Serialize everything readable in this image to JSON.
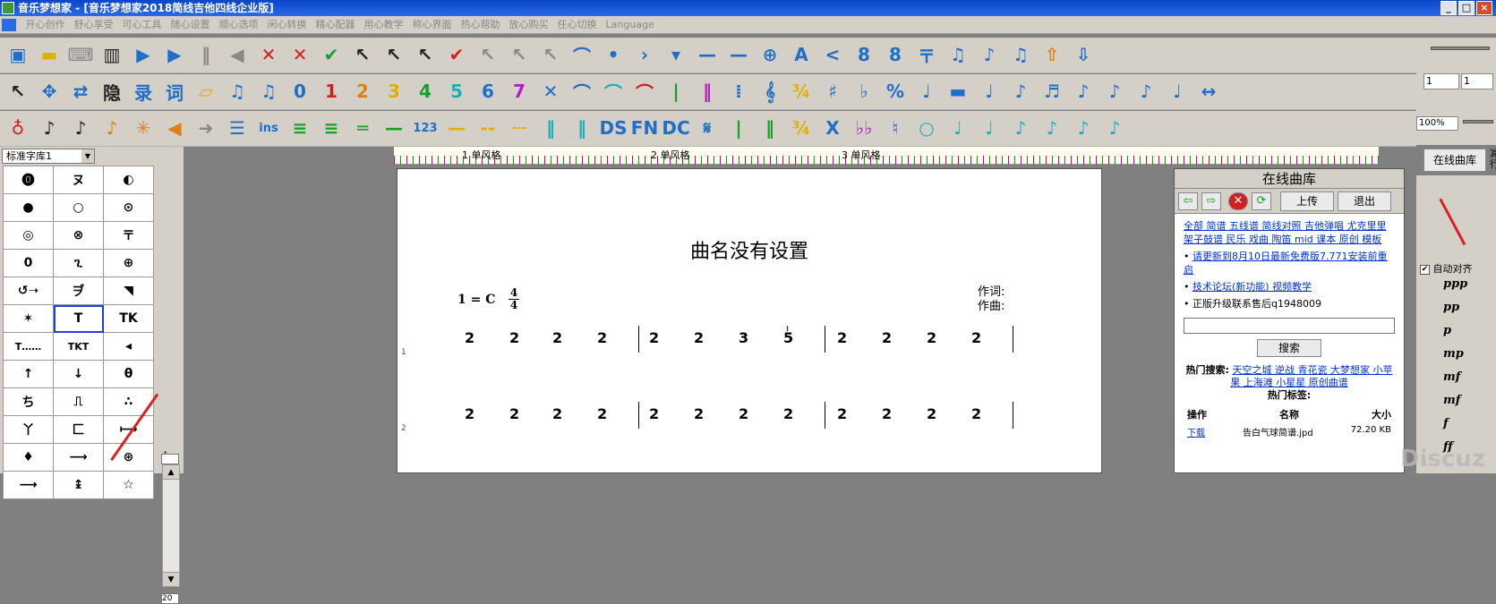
{
  "window": {
    "title": "音乐梦想家 - [音乐梦想家2018简线吉他四线企业版]",
    "min_label": "_",
    "max_label": "□",
    "close_label": "×"
  },
  "menu": [
    "开心创作",
    "舒心享受",
    "可心工具",
    "随心设置",
    "顺心选项",
    "闲心转换",
    "精心配器",
    "用心教学",
    "称心界面",
    "热心帮助",
    "放心购买",
    "任心切换",
    "Language"
  ],
  "toolbar1": [
    {
      "icon": "save-icon",
      "g": "▣",
      "c": "blue"
    },
    {
      "icon": "folder-icon",
      "g": "▬",
      "c": "yellow"
    },
    {
      "icon": "keyboard-icon",
      "g": "⌨",
      "c": "gray"
    },
    {
      "icon": "piano-icon",
      "g": "▥",
      "c": "dk"
    },
    {
      "icon": "play-icon",
      "g": "▶",
      "c": "blue"
    },
    {
      "icon": "play-from-icon",
      "g": "▶",
      "c": "blue"
    },
    {
      "icon": "pause-icon",
      "g": "‖",
      "c": "gray"
    },
    {
      "icon": "rewind-icon",
      "g": "◀",
      "c": "gray"
    },
    {
      "icon": "cut-icon",
      "g": "✕",
      "c": "red"
    },
    {
      "icon": "cut-red-icon",
      "g": "✕",
      "c": "red"
    },
    {
      "icon": "check-icon",
      "g": "✔",
      "c": "green"
    },
    {
      "icon": "select-color-icon",
      "g": "↖",
      "c": "dk"
    },
    {
      "icon": "select2-icon",
      "g": "↖",
      "c": "dk"
    },
    {
      "icon": "select3-icon",
      "g": "↖",
      "c": "dk"
    },
    {
      "icon": "abc-icon",
      "g": "✔",
      "c": "red"
    },
    {
      "icon": "select4-icon",
      "g": "↖",
      "c": "gray"
    },
    {
      "icon": "select5-icon",
      "g": "↖",
      "c": "gray"
    },
    {
      "icon": "select6-icon",
      "g": "↖",
      "c": "gray"
    },
    {
      "icon": "fermata-icon",
      "g": "⌒",
      "c": "blue"
    },
    {
      "icon": "dot-icon",
      "g": "•",
      "c": "blue"
    },
    {
      "icon": "chevron-right-icon",
      "g": "›",
      "c": "blue"
    },
    {
      "icon": "triangle-down-icon",
      "g": "▾",
      "c": "blue"
    },
    {
      "icon": "dash-icon",
      "g": "—",
      "c": "blue"
    },
    {
      "icon": "long-dash-icon",
      "g": "—",
      "c": "blue"
    },
    {
      "icon": "target-icon",
      "g": "⊕",
      "c": "blue"
    },
    {
      "icon": "text-a-icon",
      "g": "A",
      "c": "blue"
    },
    {
      "icon": "less-than-icon",
      "g": "<",
      "c": "blue"
    },
    {
      "icon": "add-8-icon",
      "g": "8",
      "c": "blue"
    },
    {
      "icon": "remove-8-icon",
      "g": "8",
      "c": "blue"
    },
    {
      "icon": "fork-icon",
      "g": "〒",
      "c": "blue"
    },
    {
      "icon": "note-icon",
      "g": "♫",
      "c": "blue"
    },
    {
      "icon": "note2-icon",
      "g": "♪",
      "c": "blue"
    },
    {
      "icon": "note3-icon",
      "g": "♫",
      "c": "blue"
    },
    {
      "icon": "upload-icon",
      "g": "⇧",
      "c": "orange"
    },
    {
      "icon": "download-icon",
      "g": "⇩",
      "c": "blue"
    }
  ],
  "toolbar2": [
    {
      "icon": "pointer-icon",
      "g": "↖",
      "c": "dk"
    },
    {
      "icon": "move-icon",
      "g": "✥",
      "c": "blue"
    },
    {
      "icon": "swap-icon",
      "g": "⇄",
      "c": "blue"
    },
    {
      "icon": "hide-icon",
      "g": "隐",
      "c": "dk"
    },
    {
      "icon": "record-icon",
      "g": "录",
      "c": "blue"
    },
    {
      "icon": "lyric-icon",
      "g": "词",
      "c": "blue"
    },
    {
      "icon": "eraser-icon",
      "g": "▱",
      "c": "yellow"
    },
    {
      "icon": "beam-icon",
      "g": "♫",
      "c": "blue"
    },
    {
      "icon": "beam2-icon",
      "g": "♫",
      "c": "blue"
    },
    {
      "icon": "num-0-icon",
      "g": "0",
      "c": "blue"
    },
    {
      "icon": "num-1-icon",
      "g": "1",
      "c": "red"
    },
    {
      "icon": "num-2-icon",
      "g": "2",
      "c": "orange"
    },
    {
      "icon": "num-3-icon",
      "g": "3",
      "c": "yellow"
    },
    {
      "icon": "num-4-icon",
      "g": "4",
      "c": "green"
    },
    {
      "icon": "num-5-icon",
      "g": "5",
      "c": "teal"
    },
    {
      "icon": "num-6-icon",
      "g": "6",
      "c": "blue"
    },
    {
      "icon": "num-7-icon",
      "g": "7",
      "c": "purple"
    },
    {
      "icon": "close-x-icon",
      "g": "✕",
      "c": "blue"
    },
    {
      "icon": "slur-icon",
      "g": "⌒",
      "c": "blue"
    },
    {
      "icon": "slur2-icon",
      "g": "⌒",
      "c": "teal"
    },
    {
      "icon": "slur3-icon",
      "g": "⌒",
      "c": "red"
    },
    {
      "icon": "bar-icon",
      "g": "|",
      "c": "green"
    },
    {
      "icon": "double-bar-icon",
      "g": "‖",
      "c": "purple"
    },
    {
      "icon": "repeat-icon",
      "g": "⁞",
      "c": "blue"
    },
    {
      "icon": "treble-clef-icon",
      "g": "𝄞",
      "c": "blue"
    },
    {
      "icon": "time-sig-icon",
      "g": "¾",
      "c": "yellow"
    },
    {
      "icon": "sharp-icon",
      "g": "♯",
      "c": "blue"
    },
    {
      "icon": "flat-icon",
      "g": "♭",
      "c": "blue"
    },
    {
      "icon": "percent-icon",
      "g": "%",
      "c": "blue"
    },
    {
      "icon": "quarter-note-icon",
      "g": "♩",
      "c": "blue"
    },
    {
      "icon": "rest-icon",
      "g": "▬",
      "c": "blue"
    },
    {
      "icon": "half-note-icon",
      "g": "♩",
      "c": "blue"
    },
    {
      "icon": "eighth-note-icon",
      "g": "♪",
      "c": "blue"
    },
    {
      "icon": "sixteenth-note-icon",
      "g": "♬",
      "c": "blue"
    },
    {
      "icon": "note-x-icon",
      "g": "♪",
      "c": "blue"
    },
    {
      "icon": "note-ghost-icon",
      "g": "♪",
      "c": "blue"
    },
    {
      "icon": "grace-note-icon",
      "g": "♪",
      "c": "blue"
    },
    {
      "icon": "note-stem-icon",
      "g": "♩",
      "c": "blue"
    },
    {
      "icon": "span-icon",
      "g": "↔",
      "c": "blue"
    }
  ],
  "toolbar3": [
    {
      "icon": "drum-icon",
      "g": "♁",
      "c": "red"
    },
    {
      "icon": "violin-icon",
      "g": "♪",
      "c": "dk"
    },
    {
      "icon": "guitar-icon",
      "g": "♪",
      "c": "dk"
    },
    {
      "icon": "sax-icon",
      "g": "♪",
      "c": "orange"
    },
    {
      "icon": "asterisk-icon",
      "g": "✳",
      "c": "orange"
    },
    {
      "icon": "arrow-left-icon",
      "g": "◀",
      "c": "orange"
    },
    {
      "icon": "arrow-right-icon",
      "g": "➜",
      "c": "gray"
    },
    {
      "icon": "lines-icon",
      "g": "☰",
      "c": "blue"
    },
    {
      "icon": "ins-icon",
      "g": "ins",
      "c": "blue"
    },
    {
      "icon": "menu-lines-icon",
      "g": "≡",
      "c": "green"
    },
    {
      "icon": "menu-lines2-icon",
      "g": "≡",
      "c": "green"
    },
    {
      "icon": "equal-icon",
      "g": "═",
      "c": "green"
    },
    {
      "icon": "line-icon",
      "g": "—",
      "c": "green"
    },
    {
      "icon": "num-123-icon",
      "g": "123",
      "c": "blue"
    },
    {
      "icon": "dash-yellow-icon",
      "g": "—",
      "c": "yellow"
    },
    {
      "icon": "dash-yellow2-icon",
      "g": "--",
      "c": "yellow"
    },
    {
      "icon": "dash-yellow3-icon",
      "g": "---",
      "c": "yellow"
    },
    {
      "icon": "repeat-start-icon",
      "g": "‖",
      "c": "teal"
    },
    {
      "icon": "repeat-end-icon",
      "g": "‖",
      "c": "teal"
    },
    {
      "icon": "ds-icon",
      "g": "DS",
      "c": "blue"
    },
    {
      "icon": "fn-icon",
      "g": "FN",
      "c": "blue"
    },
    {
      "icon": "dc-icon",
      "g": "DC",
      "c": "blue"
    },
    {
      "icon": "segno-icon",
      "g": "𝄋",
      "c": "blue"
    },
    {
      "icon": "bar-green-icon",
      "g": "|",
      "c": "green"
    },
    {
      "icon": "bar-green2-icon",
      "g": "‖",
      "c": "green"
    },
    {
      "icon": "time-sig2-icon",
      "g": "¾",
      "c": "yellow"
    },
    {
      "icon": "x-icon",
      "g": "X",
      "c": "blue"
    },
    {
      "icon": "double-flat-icon",
      "g": "♭♭",
      "c": "purple"
    },
    {
      "icon": "natural-icon",
      "g": "♮",
      "c": "blue"
    },
    {
      "icon": "whole-note-icon",
      "g": "○",
      "c": "teal"
    },
    {
      "icon": "q-note-icon",
      "g": "♩",
      "c": "teal"
    },
    {
      "icon": "q-note2-icon",
      "g": "♩",
      "c": "teal"
    },
    {
      "icon": "e-note-icon",
      "g": "♪",
      "c": "teal"
    },
    {
      "icon": "e-note2-icon",
      "g": "♪",
      "c": "teal"
    },
    {
      "icon": "e-note3-icon",
      "g": "♪",
      "c": "teal"
    },
    {
      "icon": "e-note4-icon",
      "g": "♪",
      "c": "teal"
    }
  ],
  "right_tools": {
    "box1": "1",
    "box2": "1",
    "zoom": "100%"
  },
  "symbol_library": {
    "selected": "标准字库1",
    "rows": [
      [
        "⓿",
        "ヌ",
        "◐"
      ],
      [
        "●",
        "○",
        "⊙"
      ],
      [
        "◎",
        "⊗",
        "〒"
      ],
      [
        "0",
        "ጊ",
        "⊕"
      ],
      [
        "↺➝",
        "ヺ",
        "◥"
      ],
      [
        "✶",
        "T",
        "TK"
      ],
      [
        "T……",
        "TKT",
        "◂"
      ],
      [
        "↑",
        "↓",
        "θ"
      ],
      [
        "ち",
        "⎍",
        "∴"
      ],
      [
        "丫",
        "匚",
        "⟼"
      ],
      [
        "♦",
        "⟶",
        "⊛"
      ],
      [
        "⟶",
        "↨",
        "☆"
      ]
    ],
    "scroll_top": "▲",
    "scroll_bottom": "▼",
    "scroll_num": "1",
    "scroll_num2": "20"
  },
  "ruler": {
    "m1": "1 单风格",
    "m2": "2 单风格",
    "m3": "3 单风格"
  },
  "score": {
    "title": "曲名没有设置",
    "key": "1 = C",
    "time_top": "4",
    "time_bottom": "4",
    "lyricist": "作词:",
    "composer": "作曲:",
    "sys1": "1",
    "sys2": "2",
    "line1": [
      "2",
      "2",
      "2",
      "2",
      "2",
      "2",
      "3",
      "5",
      "2",
      "2",
      "2",
      "2"
    ],
    "line2": [
      "2",
      "2",
      "2",
      "2",
      "2",
      "2",
      "2",
      "2",
      "2",
      "2",
      "2",
      "2"
    ]
  },
  "library": {
    "header": "在线曲库",
    "upload": "上传",
    "logout": "退出",
    "cats": "全部 简谱 五线谱 简线对照 吉他弹唱 尤克里里 架子鼓谱 民乐 戏曲 陶笛 mid 课本 原创 模板",
    "news1": "请更新到8月10日最新免费版7.771安装前重启",
    "news2": "技术论坛(新功能) 视频教学",
    "news3": "正版升级联系售后q1948009",
    "search": "搜索",
    "hot_label": "热门搜索:",
    "hot": "天空之城 逆战 青花瓷 大梦想家 小苹果 上海滩 小星星 原创曲谱",
    "tags": "热门标签:",
    "col_action": "操作",
    "col_name": "名称",
    "col_size": "大小",
    "row_action": "下载",
    "row_name": "告白气球简谱.jpd",
    "row_size": "72.20 KB"
  },
  "online_btn": "在线曲库",
  "online_btn2": "减行",
  "auto_align": "自动对齐",
  "dynamics": [
    "ppp",
    "pp",
    "p",
    "mp",
    "mf",
    "mf",
    "f",
    "ff"
  ],
  "watermark": "Discuz"
}
